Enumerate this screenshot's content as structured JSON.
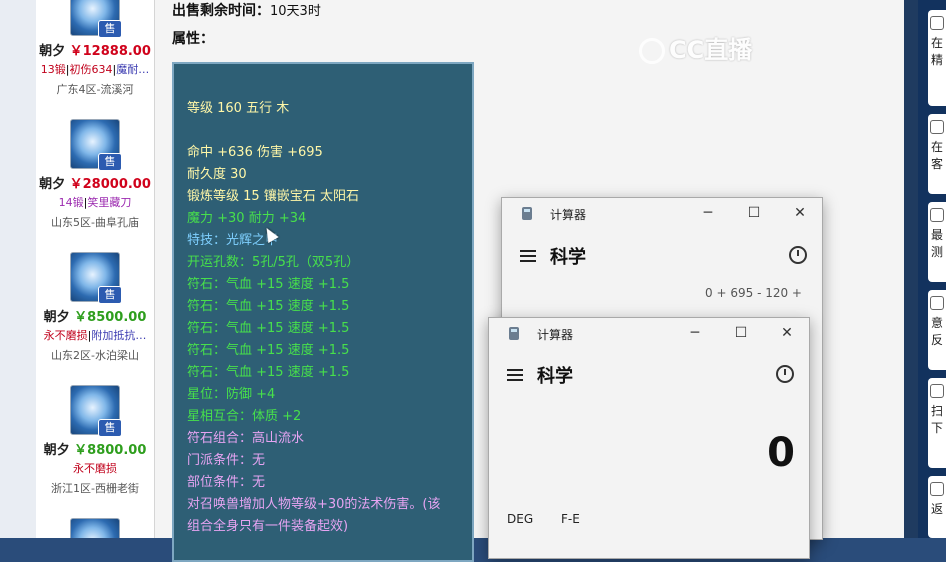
{
  "listing": {
    "items": [
      {
        "server": "朝夕",
        "price": "￥12888.00",
        "price_color": "red",
        "attrs": [
          "13锻",
          "初伤634",
          "魔耐…"
        ],
        "separator": "|",
        "location": "广东4区-流溪河",
        "badge": "售"
      },
      {
        "server": "朝夕",
        "price": "￥28000.00",
        "price_color": "red",
        "attrs": [
          "14锻",
          "笑里藏刀"
        ],
        "separator": "|",
        "location": "山东5区-曲阜孔庙",
        "badge": "售"
      },
      {
        "server": "朝夕",
        "price": "￥8500.00",
        "price_color": "green",
        "attrs": [
          "永不磨损",
          "附加抵抗…"
        ],
        "separator": "|",
        "location": "山东2区-水泊梁山",
        "badge": "售"
      },
      {
        "server": "朝夕",
        "price": "￥8800.00",
        "price_color": "green",
        "attrs": [
          "永不磨损"
        ],
        "separator": "",
        "location": "浙江1区-西栅老街",
        "badge": "售"
      }
    ]
  },
  "main": {
    "sale_time_label": "出售剩余时间：",
    "sale_time_value": "10天3时",
    "attributes_label": "属性：",
    "attribute_lines": [
      {
        "text": "等级 160 五行 木",
        "color": "yellow"
      },
      {
        "text": "命中 +636 伤害 +695",
        "color": "yellow"
      },
      {
        "text": "耐久度 30",
        "color": "yellow"
      },
      {
        "text": "锻炼等级 15 镶嵌宝石 太阳石",
        "color": "yellow"
      },
      {
        "text": "魔力 +30 耐力 +34",
        "color": "green"
      },
      {
        "text": "特技：光辉之甲",
        "color": "blue"
      },
      {
        "text": "开运孔数：5孔/5孔（双5孔）",
        "color": "green"
      },
      {
        "text": "符石：气血 +15 速度 +1.5",
        "color": "green"
      },
      {
        "text": "符石：气血 +15 速度 +1.5",
        "color": "green"
      },
      {
        "text": "符石：气血 +15 速度 +1.5",
        "color": "green"
      },
      {
        "text": "符石：气血 +15 速度 +1.5",
        "color": "green"
      },
      {
        "text": "符石：气血 +15 速度 +1.5",
        "color": "green"
      },
      {
        "text": "星位：防御 +4",
        "color": "green"
      },
      {
        "text": "星相互合：体质 +2",
        "color": "green"
      },
      {
        "text": "符石组合：高山流水",
        "color": "purple"
      },
      {
        "text": "门派条件：无",
        "color": "purple"
      },
      {
        "text": "部位条件：无",
        "color": "purple"
      },
      {
        "text": "对召唤兽增加人物等级+30的法术伤害。(该",
        "color": "purple"
      },
      {
        "text": "组合全身只有一件装备起效)",
        "color": "purple"
      }
    ]
  },
  "watermark": "CC直播",
  "right_panel": {
    "items": [
      "在精",
      "在客",
      "最测",
      "意反",
      "扫下",
      "返"
    ]
  },
  "calculator_back": {
    "title": "计算器",
    "mode": "科学",
    "expression": "0 + 695 - 120 +",
    "minimize": "─",
    "maximize": "☐",
    "close": "✕"
  },
  "calculator_front": {
    "title": "计算器",
    "mode": "科学",
    "display": "0",
    "deg_label": "DEG",
    "fe_label": "F-E",
    "minimize": "─",
    "maximize": "☐",
    "close": "✕"
  },
  "colors": {
    "panel_bg": "#2e5f75",
    "yellow": "#fff7a8",
    "green": "#47e04b",
    "blue": "#7fd0ff",
    "purple": "#e6a4f2",
    "price_red": "#d0021b",
    "price_green": "#2e9e1d"
  }
}
